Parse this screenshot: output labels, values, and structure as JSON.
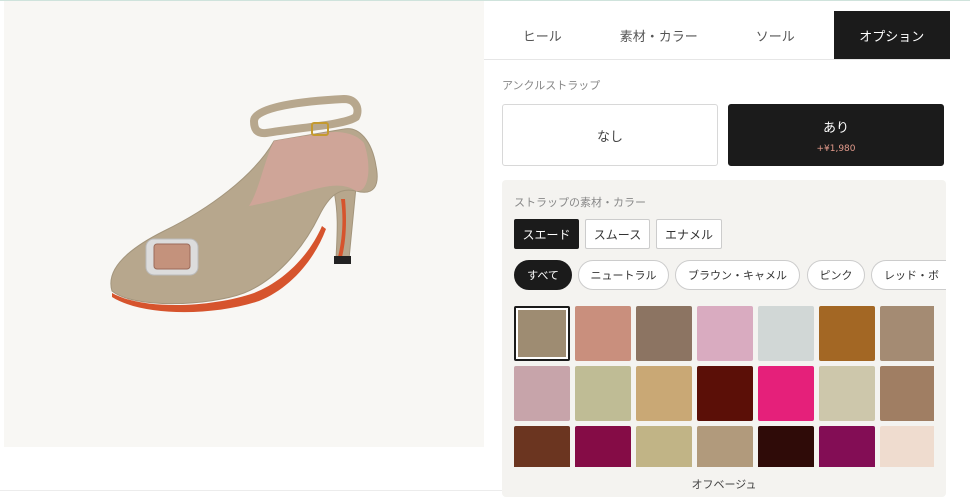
{
  "tabs": [
    {
      "label": "ヒール",
      "active": false
    },
    {
      "label": "素材・カラー",
      "active": false
    },
    {
      "label": "ソール",
      "active": false
    },
    {
      "label": "オプション",
      "active": true
    }
  ],
  "ankle_strap": {
    "label": "アンクルストラップ",
    "options": [
      {
        "label": "なし",
        "price": ""
      },
      {
        "label": "あり",
        "price": "+¥1,980",
        "selected": true
      }
    ]
  },
  "strap_material": {
    "label": "ストラップの素材・カラー",
    "materials": [
      {
        "label": "スエード",
        "active": true
      },
      {
        "label": "スムース",
        "active": false
      },
      {
        "label": "エナメル",
        "active": false
      }
    ],
    "filters": [
      {
        "label": "すべて",
        "active": true
      },
      {
        "label": "ニュートラル",
        "active": false
      },
      {
        "label": "ブラウン・キャメル",
        "active": false
      },
      {
        "label": "ピンク",
        "active": false
      },
      {
        "label": "レッド・ボ",
        "active": false
      }
    ],
    "swatches": [
      "#9e8c72",
      "#c98f7d",
      "#8c7462",
      "#d9abc0",
      "#d1d7d6",
      "#a36724",
      "#a48b73",
      "#c7a4aa",
      "#bfbc95",
      "#c9a875",
      "#5b0f07",
      "#e5207a",
      "#cdc7ab",
      "#a07e63",
      "#6b3520",
      "#850c46",
      "#c1b486",
      "#b19a7c",
      "#2f0b08",
      "#830d55",
      "#efdccf"
    ],
    "selected_index": 0,
    "selected_name": "オフベージュ"
  },
  "colors": {
    "accent": "#1b1b1b",
    "price": "#e29a8b",
    "shoe_upper": "#b7a78d",
    "shoe_sole": "#d6542d"
  }
}
